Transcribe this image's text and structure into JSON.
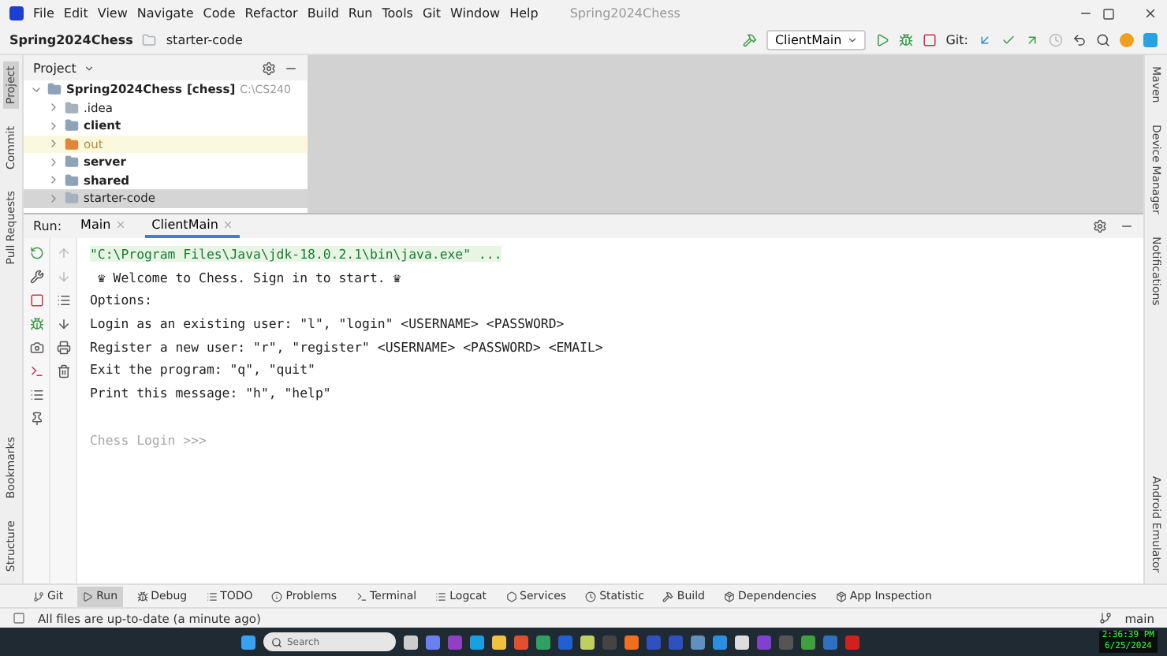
{
  "window": {
    "title": "Spring2024Chess"
  },
  "menu": [
    "File",
    "Edit",
    "View",
    "Navigate",
    "Code",
    "Refactor",
    "Build",
    "Run",
    "Tools",
    "Git",
    "Window",
    "Help"
  ],
  "breadcrumbs": [
    "Spring2024Chess",
    "starter-code"
  ],
  "toolbar": {
    "run_config": "ClientMain",
    "git_label": "Git:"
  },
  "left_stripe_top": [
    {
      "label": "Project",
      "selected": true
    },
    {
      "label": "Commit",
      "selected": false
    },
    {
      "label": "Pull Requests",
      "selected": false
    }
  ],
  "left_stripe_bottom": [
    {
      "label": "Bookmarks",
      "selected": false
    },
    {
      "label": "Structure",
      "selected": false
    }
  ],
  "right_stripe_top": [
    "Maven",
    "Device Manager",
    "Notifications"
  ],
  "right_stripe_bottom": [
    "Android Emulator"
  ],
  "project_panel": {
    "title": "Project",
    "tree": [
      {
        "label": "Spring2024Chess",
        "module": "[chess]",
        "path": "C:\\CS240",
        "kind": "module",
        "expanded": true,
        "selected": false,
        "children": [
          {
            "label": ".idea",
            "kind": "folder",
            "expanded": false,
            "selected": false
          },
          {
            "label": "client",
            "kind": "module",
            "expanded": false,
            "selected": false
          },
          {
            "label": "out",
            "kind": "excluded",
            "expanded": false,
            "selected": false
          },
          {
            "label": "server",
            "kind": "module",
            "expanded": false,
            "selected": false
          },
          {
            "label": "shared",
            "kind": "module",
            "expanded": false,
            "selected": false
          },
          {
            "label": "starter-code",
            "kind": "folder",
            "expanded": false,
            "selected": true
          }
        ]
      }
    ]
  },
  "run_panel": {
    "label": "Run:",
    "tabs": [
      {
        "label": "Main",
        "selected": false
      },
      {
        "label": "ClientMain",
        "selected": true
      }
    ],
    "console": [
      {
        "kind": "command",
        "text": "\"C:\\Program Files\\Java\\jdk-18.0.2.1\\bin\\java.exe\" ..."
      },
      {
        "kind": "output",
        "text": " ♛ Welcome to Chess. Sign in to start. ♛"
      },
      {
        "kind": "output",
        "text": "Options:"
      },
      {
        "kind": "output",
        "text": "Login as an existing user: \"l\", \"login\" <USERNAME> <PASSWORD>"
      },
      {
        "kind": "output",
        "text": "Register a new user: \"r\", \"register\" <USERNAME> <PASSWORD> <EMAIL>"
      },
      {
        "kind": "output",
        "text": "Exit the program: \"q\", \"quit\""
      },
      {
        "kind": "output",
        "text": "Print this message: \"h\", \"help\""
      },
      {
        "kind": "prompt",
        "text": "Chess Login >>>"
      }
    ]
  },
  "tool_windows": [
    {
      "label": "Git",
      "selected": false
    },
    {
      "label": "Run",
      "selected": true
    },
    {
      "label": "Debug",
      "selected": false
    },
    {
      "label": "TODO",
      "selected": false
    },
    {
      "label": "Problems",
      "selected": false
    },
    {
      "label": "Terminal",
      "selected": false
    },
    {
      "label": "Logcat",
      "selected": false
    },
    {
      "label": "Services",
      "selected": false
    },
    {
      "label": "Statistic",
      "selected": false
    },
    {
      "label": "Build",
      "selected": false
    },
    {
      "label": "Dependencies",
      "selected": false
    },
    {
      "label": "App Inspection",
      "selected": false
    }
  ],
  "status_bar": {
    "message": "All files are up-to-date (a minute ago)",
    "branch": "main"
  },
  "taskbar": {
    "search_placeholder": "Search",
    "time": "2:36:39 PM",
    "date": "6/25/2024"
  }
}
